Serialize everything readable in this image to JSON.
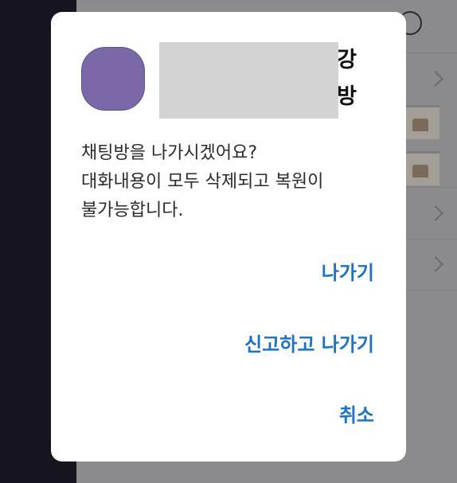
{
  "dialog": {
    "chat_name_line1": "강",
    "chat_name_line2": "방",
    "message_line1": "채팅방을 나가시겠어요?",
    "message_line2": "대화내용이 모두 삭제되고 복원이",
    "message_line3": "불가능합니다.",
    "actions": {
      "leave": "나가기",
      "report_and_leave": "신고하고 나가기",
      "cancel": "취소"
    }
  },
  "colors": {
    "avatar": "#7b68a8",
    "action_text": "#1a73c8",
    "scrim": "#8c8c8e",
    "left_panel": "#15141f"
  },
  "icons": {
    "search": "search-icon",
    "row_chevron": "chevron-right-icon"
  }
}
